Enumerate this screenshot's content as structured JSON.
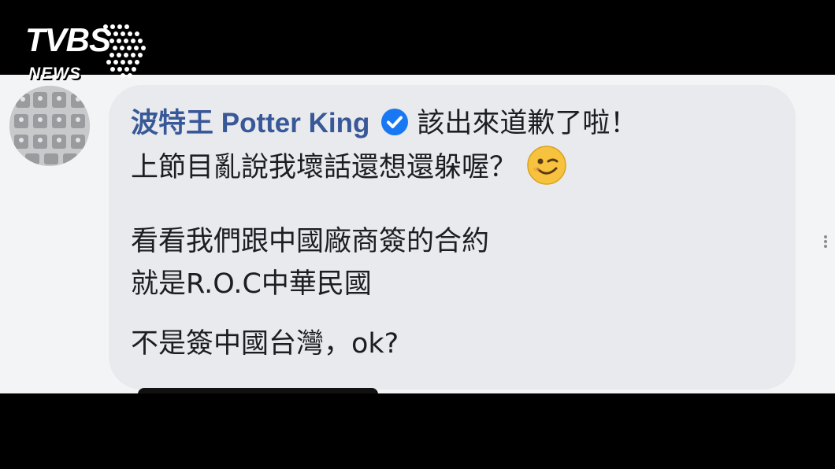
{
  "broadcaster": {
    "logo_main": "TVBS",
    "logo_sub": "NEWS"
  },
  "comment": {
    "author": "波特王 Potter King",
    "verified_icon": "verified-badge-icon",
    "lines": [
      "該出來道歉了啦！",
      "上節目亂說我壞話還想還躲喔？",
      "看看我們跟中國廠商簽的合約",
      "就是R.O.C中華民國",
      "不是簽中國台灣，ok?"
    ],
    "emoji": "winking-face-emoji"
  },
  "colors": {
    "author_link": "#385898",
    "verified_badge": "#1877f2",
    "bubble_bg": "#e9eaed",
    "page_bg": "#f3f4f6",
    "text": "#1c1e21"
  }
}
